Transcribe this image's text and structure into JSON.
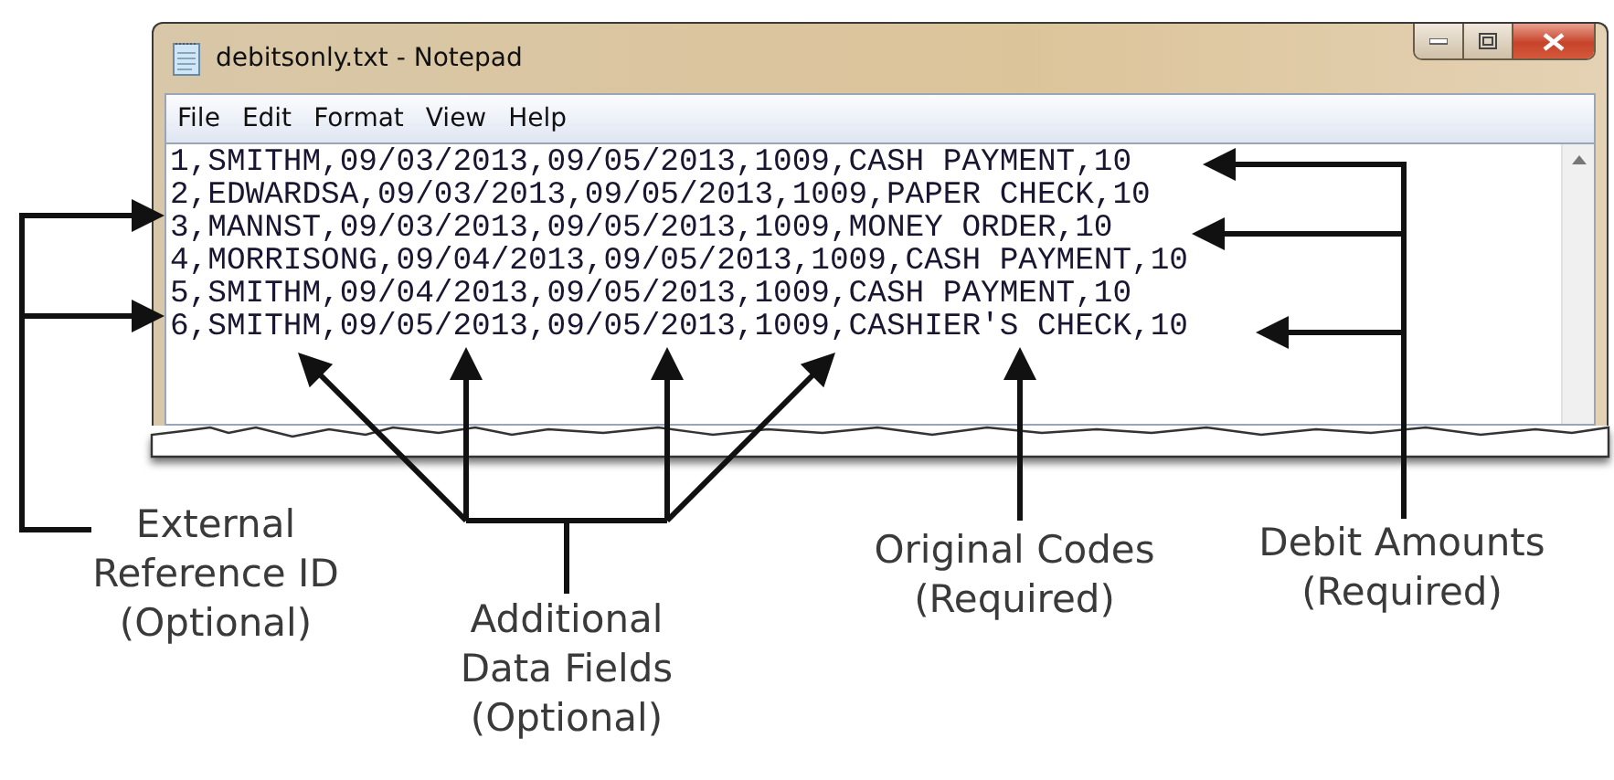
{
  "window": {
    "title": "debitsonly.txt - Notepad"
  },
  "menu": [
    "File",
    "Edit",
    "Format",
    "View",
    "Help"
  ],
  "lines": [
    "1,SMITHM,09/03/2013,09/05/2013,1009,CASH PAYMENT,10",
    "2,EDWARDSA,09/03/2013,09/05/2013,1009,PAPER CHECK,10",
    "3,MANNST,09/03/2013,09/05/2013,1009,MONEY ORDER,10",
    "4,MORRISONG,09/04/2013,09/05/2013,1009,CASH PAYMENT,10",
    "5,SMITHM,09/04/2013,09/05/2013,1009,CASH PAYMENT,10",
    "6,SMITHM,09/05/2013,09/05/2013,1009,CASHIER'S CHECK,10"
  ],
  "annotations": [
    {
      "label": [
        "External",
        "Reference ID",
        "(Optional)"
      ]
    },
    {
      "label": [
        "Additional",
        "Data Fields",
        "(Optional)"
      ]
    },
    {
      "label": [
        "Original Codes",
        "(Required)"
      ]
    },
    {
      "label": [
        "Debit Amounts",
        "(Required)"
      ]
    }
  ]
}
